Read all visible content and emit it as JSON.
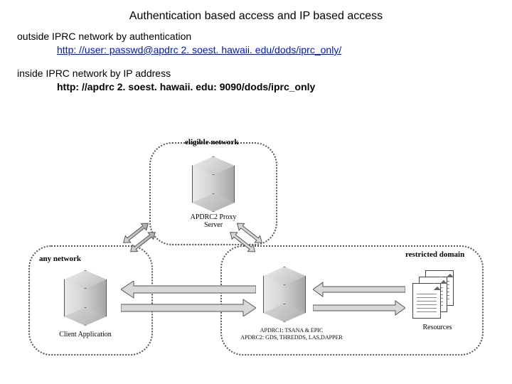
{
  "title": "Authentication based access and IP based access",
  "outside": {
    "text": "outside IPRC network by authentication",
    "url": "http: //user: passwd@apdrc 2. soest. hawaii. edu/dods/iprc_only/"
  },
  "inside": {
    "text": "inside IPRC network  by IP address",
    "url": "http: //apdrc 2. soest. hawaii. edu: 9090/dods/iprc_only"
  },
  "diagram": {
    "groups": {
      "eligible": "eligible network",
      "any": "any network",
      "restricted": "restricted domain"
    },
    "nodes": {
      "proxy": "APDRC2 Proxy\nServer",
      "client": "Client Application",
      "apdrc_line1": "APDRC1: TSANA & EPIC",
      "apdrc_line2": "APDRC2: GDS, THREDDS, LAS,DAPPER",
      "resources": "Resources"
    }
  }
}
